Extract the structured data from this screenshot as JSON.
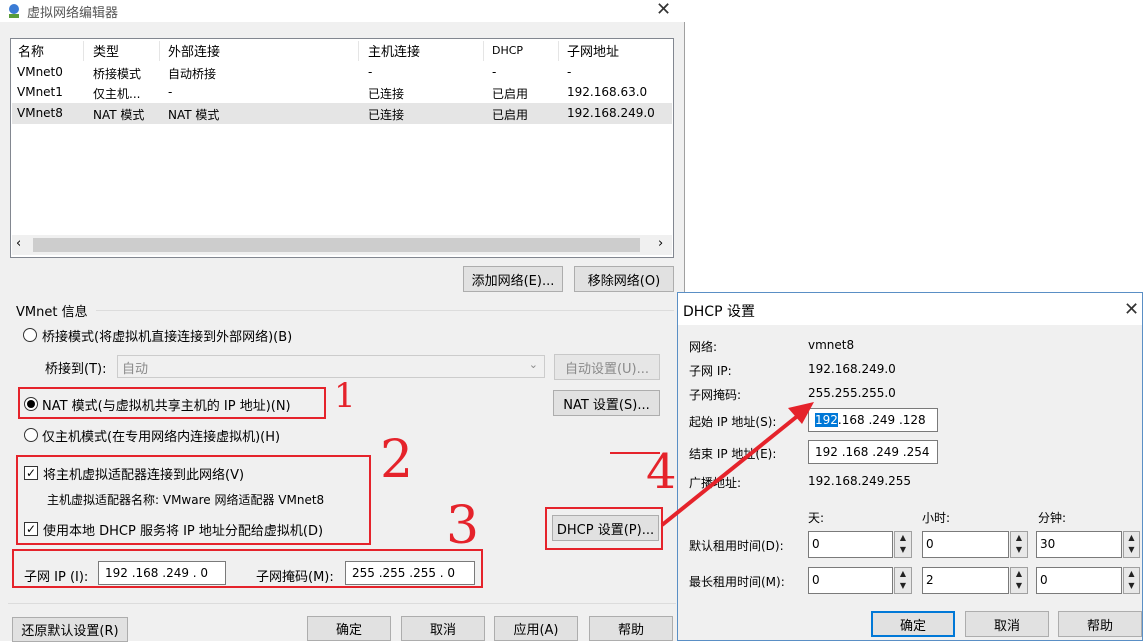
{
  "main_window": {
    "title": "虚拟网络编辑器",
    "list": {
      "headers": [
        "名称",
        "类型",
        "外部连接",
        "主机连接",
        "DHCP",
        "子网地址"
      ],
      "rows": [
        [
          "VMnet0",
          "桥接模式",
          "自动桥接",
          "-",
          "-",
          "-"
        ],
        [
          "VMnet1",
          "仅主机...",
          "-",
          "已连接",
          "已启用",
          "192.168.63.0"
        ],
        [
          "VMnet8",
          "NAT 模式",
          "NAT 模式",
          "已连接",
          "已启用",
          "192.168.249.0"
        ]
      ]
    },
    "add_network": "添加网络(E)...",
    "remove_network": "移除网络(O)",
    "vmnet_info": "VMnet 信息",
    "bridge_mode": "桥接模式(将虚拟机直接连接到外部网络)(B)",
    "bridge_to_label": "桥接到(T):",
    "bridge_to_value": "自动",
    "auto_settings": "自动设置(U)...",
    "nat_mode": "NAT 模式(与虚拟机共享主机的 IP 地址)(N)",
    "nat_settings": "NAT 设置(S)...",
    "host_only_mode": "仅主机模式(在专用网络内连接虚拟机)(H)",
    "connect_adapter": "将主机虚拟适配器连接到此网络(V)",
    "adapter_name": "主机虚拟适配器名称: VMware 网络适配器 VMnet8",
    "use_dhcp": "使用本地 DHCP 服务将 IP 地址分配给虚拟机(D)",
    "dhcp_settings": "DHCP 设置(P)...",
    "subnet_ip_label": "子网 IP (I):",
    "subnet_ip_value": "192 .168 .249 .  0",
    "subnet_mask_label": "子网掩码(M):",
    "subnet_mask_value": "255 .255 .255 .  0",
    "restore_defaults": "还原默认设置(R)",
    "ok": "确定",
    "cancel": "取消",
    "apply": "应用(A)",
    "help": "帮助"
  },
  "annotations": {
    "n1": "1",
    "n2": "2",
    "n3": "3",
    "n4": "4"
  },
  "dhcp_dialog": {
    "title": "DHCP 设置",
    "network_label": "网络:",
    "network_value": "vmnet8",
    "subnet_ip_label": "子网 IP:",
    "subnet_ip_value": "192.168.249.0",
    "subnet_mask_label": "子网掩码:",
    "subnet_mask_value": "255.255.255.0",
    "start_ip_label": "起始 IP 地址(S):",
    "start_ip_first": "192",
    "start_ip_rest": ".168 .249 .128",
    "end_ip_label": "结束 IP 地址(E):",
    "end_ip_value": "192 .168 .249 .254",
    "broadcast_label": "广播地址:",
    "broadcast_value": "192.168.249.255",
    "day_label": "天:",
    "hour_label": "小时:",
    "minute_label": "分钟:",
    "default_lease_label": "默认租用时间(D):",
    "default_lease": [
      "0",
      "0",
      "30"
    ],
    "max_lease_label": "最长租用时间(M):",
    "max_lease": [
      "0",
      "2",
      "0"
    ],
    "ok": "确定",
    "cancel": "取消",
    "help": "帮助"
  }
}
